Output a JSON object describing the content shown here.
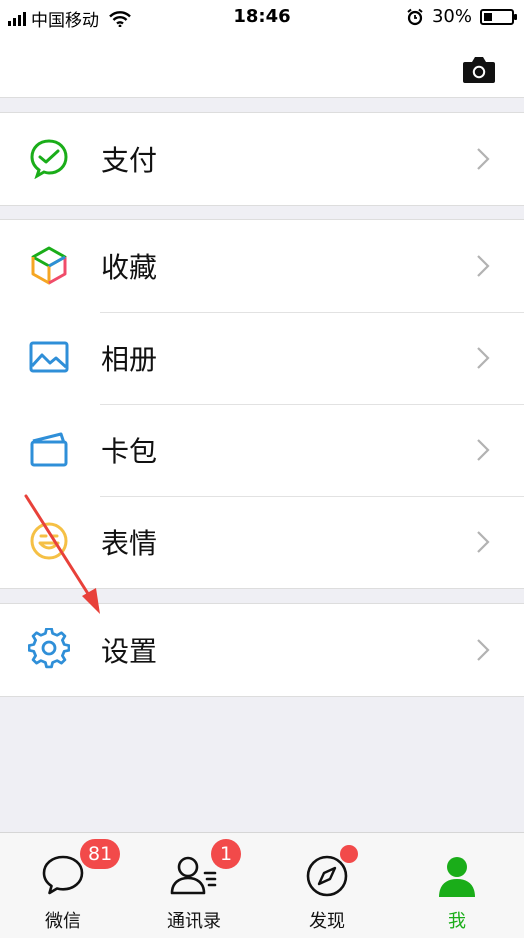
{
  "status_bar": {
    "carrier": "中国移动",
    "time": "18:46",
    "battery": "30%",
    "battery_level": 0.3
  },
  "header": {
    "camera_icon": "camera-icon"
  },
  "groups": [
    {
      "items": [
        {
          "label": "支付",
          "icon": "payment-icon",
          "color": "#1aad19"
        }
      ]
    },
    {
      "items": [
        {
          "label": "收藏",
          "icon": "favorites-cube-icon",
          "color": "#f5a623"
        },
        {
          "label": "相册",
          "icon": "album-icon",
          "color": "#2f8fd8"
        },
        {
          "label": "卡包",
          "icon": "card-wallet-icon",
          "color": "#2f8fd8"
        },
        {
          "label": "表情",
          "icon": "sticker-smile-icon",
          "color": "#f5c045"
        }
      ]
    },
    {
      "items": [
        {
          "label": "设置",
          "icon": "gear-icon",
          "color": "#2f8fd8"
        }
      ]
    }
  ],
  "tabbar": {
    "tabs": [
      {
        "label": "微信",
        "icon": "chat-bubble-icon",
        "badge": "81"
      },
      {
        "label": "通讯录",
        "icon": "contacts-icon",
        "badge": "1"
      },
      {
        "label": "发现",
        "icon": "compass-icon",
        "dot": true
      },
      {
        "label": "我",
        "icon": "me-person-icon",
        "active": true
      }
    ]
  },
  "colors": {
    "accent": "#1aad19",
    "badge": "#f24a4a",
    "background": "#efeff4",
    "annotation_arrow": "#e8413a"
  }
}
